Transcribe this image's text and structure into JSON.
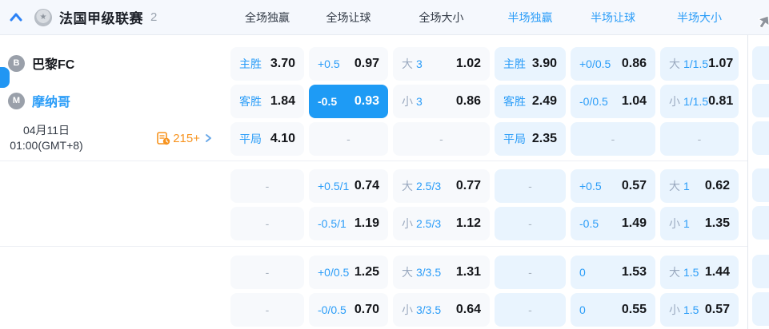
{
  "header": {
    "league": "法国甲级联赛",
    "count": "2",
    "columns": [
      {
        "label": "全场独赢",
        "type": "full"
      },
      {
        "label": "全场让球",
        "type": "full"
      },
      {
        "label": "全场大小",
        "type": "full"
      },
      {
        "label": "半场独赢",
        "type": "half"
      },
      {
        "label": "半场让球",
        "type": "half"
      },
      {
        "label": "半场大小",
        "type": "half"
      }
    ]
  },
  "match": {
    "home": {
      "initial": "B",
      "name": "巴黎FC"
    },
    "away": {
      "initial": "M",
      "name": "摩纳哥"
    },
    "date": "04月11日",
    "time": "01:00(GMT+8)",
    "more_markets": "215+"
  },
  "odds_rows": [
    {
      "cells": [
        {
          "g": "",
          "b": "主胜",
          "v": "3.70"
        },
        {
          "g": "",
          "b": "+0.5",
          "v": "0.97"
        },
        {
          "g": "大",
          "b": "3",
          "v": "1.02"
        },
        {
          "g": "",
          "b": "主胜",
          "v": "3.90"
        },
        {
          "g": "",
          "b": "+0/0.5",
          "v": "0.86"
        },
        {
          "g": "大",
          "b": "1/1.5",
          "v": "1.07"
        }
      ]
    },
    {
      "cells": [
        {
          "g": "",
          "b": "客胜",
          "v": "1.84"
        },
        {
          "g": "",
          "b": "-0.5",
          "v": "0.93",
          "sel": true
        },
        {
          "g": "小",
          "b": "3",
          "v": "0.86"
        },
        {
          "g": "",
          "b": "客胜",
          "v": "2.49"
        },
        {
          "g": "",
          "b": "-0/0.5",
          "v": "1.04"
        },
        {
          "g": "小",
          "b": "1/1.5",
          "v": "0.81"
        }
      ]
    },
    {
      "cells": [
        {
          "g": "",
          "b": "平局",
          "v": "4.10"
        },
        {
          "g": "",
          "b": "",
          "v": "-"
        },
        {
          "g": "",
          "b": "",
          "v": "-"
        },
        {
          "g": "",
          "b": "平局",
          "v": "2.35"
        },
        {
          "g": "",
          "b": "",
          "v": "-"
        },
        {
          "g": "",
          "b": "",
          "v": "-"
        }
      ]
    },
    {
      "cells": [
        {
          "g": "",
          "b": "",
          "v": "-"
        },
        {
          "g": "",
          "b": "+0.5/1",
          "v": "0.74"
        },
        {
          "g": "大",
          "b": "2.5/3",
          "v": "0.77"
        },
        {
          "g": "",
          "b": "",
          "v": "-"
        },
        {
          "g": "",
          "b": "+0.5",
          "v": "0.57"
        },
        {
          "g": "大",
          "b": "1",
          "v": "0.62"
        }
      ]
    },
    {
      "cells": [
        {
          "g": "",
          "b": "",
          "v": "-"
        },
        {
          "g": "",
          "b": "-0.5/1",
          "v": "1.19"
        },
        {
          "g": "小",
          "b": "2.5/3",
          "v": "1.12"
        },
        {
          "g": "",
          "b": "",
          "v": "-"
        },
        {
          "g": "",
          "b": "-0.5",
          "v": "1.49"
        },
        {
          "g": "小",
          "b": "1",
          "v": "1.35"
        }
      ]
    },
    {
      "cells": [
        {
          "g": "",
          "b": "",
          "v": "-"
        },
        {
          "g": "",
          "b": "+0/0.5",
          "v": "1.25"
        },
        {
          "g": "大",
          "b": "3/3.5",
          "v": "1.31"
        },
        {
          "g": "",
          "b": "",
          "v": "-"
        },
        {
          "g": "",
          "b": "0",
          "v": "1.53"
        },
        {
          "g": "大",
          "b": "1.5",
          "v": "1.44"
        }
      ]
    },
    {
      "cells": [
        {
          "g": "",
          "b": "",
          "v": "-"
        },
        {
          "g": "",
          "b": "-0/0.5",
          "v": "0.70"
        },
        {
          "g": "小",
          "b": "3/3.5",
          "v": "0.64"
        },
        {
          "g": "",
          "b": "",
          "v": "-"
        },
        {
          "g": "",
          "b": "0",
          "v": "0.55"
        },
        {
          "g": "小",
          "b": "1.5",
          "v": "0.57"
        }
      ]
    }
  ],
  "colors": {
    "accent": "#2b9df8",
    "selected_bg": "#1e9bf5",
    "full_cell_bg": "#f7f9fc",
    "half_cell_bg": "#e9f4fe",
    "orange": "#f7931e"
  }
}
